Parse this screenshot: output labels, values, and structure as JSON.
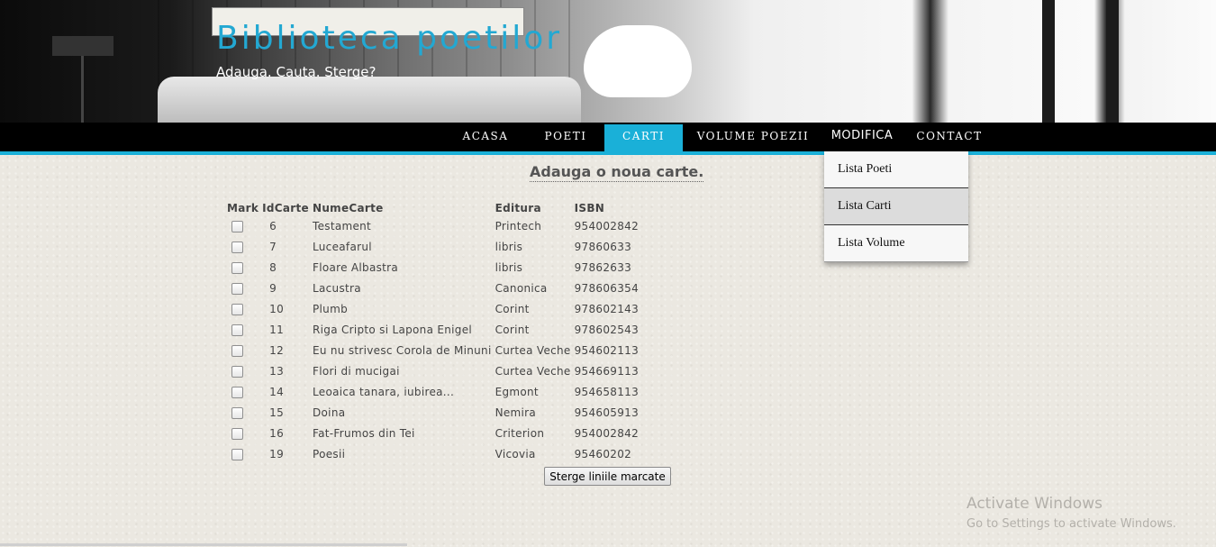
{
  "header": {
    "title": "Biblioteca poetilor",
    "tagline": "Adauga. Cauta. Sterge?"
  },
  "nav": {
    "items": [
      {
        "label": "ACASA"
      },
      {
        "label": "POETI"
      },
      {
        "label": "CARTI",
        "active": true
      },
      {
        "label": "VOLUME POEZII"
      },
      {
        "label": "MODIFICA"
      },
      {
        "label": "CONTACT"
      }
    ],
    "active_color": "#1ab0d8"
  },
  "dropdown": {
    "items": [
      {
        "label": "Lista Poeti"
      },
      {
        "label": "Lista Carti",
        "hovered": true
      },
      {
        "label": "Lista Volume"
      }
    ]
  },
  "main": {
    "heading": "Adauga o noua carte.",
    "table": {
      "headers": [
        "Mark",
        "IdCarte",
        "NumeCarte",
        "Editura",
        "ISBN"
      ],
      "rows": [
        {
          "id": "6",
          "name": "Testament",
          "editura": "Printech",
          "isbn": "954002842"
        },
        {
          "id": "7",
          "name": "Luceafarul",
          "editura": "libris",
          "isbn": "97860633"
        },
        {
          "id": "8",
          "name": "Floare Albastra",
          "editura": "libris",
          "isbn": "97862633"
        },
        {
          "id": "9",
          "name": "Lacustra",
          "editura": "Canonica",
          "isbn": "978606354"
        },
        {
          "id": "10",
          "name": "Plumb",
          "editura": "Corint",
          "isbn": "978602143"
        },
        {
          "id": "11",
          "name": "Riga Cripto si Lapona Enigel",
          "editura": "Corint",
          "isbn": "978602543"
        },
        {
          "id": "12",
          "name": "Eu nu strivesc Corola de Minuni",
          "editura": "Curtea Veche",
          "isbn": "954602113"
        },
        {
          "id": "13",
          "name": "Flori di mucigai",
          "editura": "Curtea Veche",
          "isbn": "954669113"
        },
        {
          "id": "14",
          "name": "Leoaica tanara, iubirea...",
          "editura": "Egmont",
          "isbn": "954658113"
        },
        {
          "id": "15",
          "name": "Doina",
          "editura": "Nemira",
          "isbn": "954605913"
        },
        {
          "id": "16",
          "name": "Fat-Frumos din Tei",
          "editura": "Criterion",
          "isbn": "954002842"
        },
        {
          "id": "19",
          "name": "Poesii",
          "editura": "Vicovia",
          "isbn": "95460202"
        }
      ]
    },
    "delete_button_label": "Sterge liniile marcate"
  },
  "watermark": {
    "title": "Activate Windows",
    "subtitle": "Go to Settings to activate Windows."
  }
}
